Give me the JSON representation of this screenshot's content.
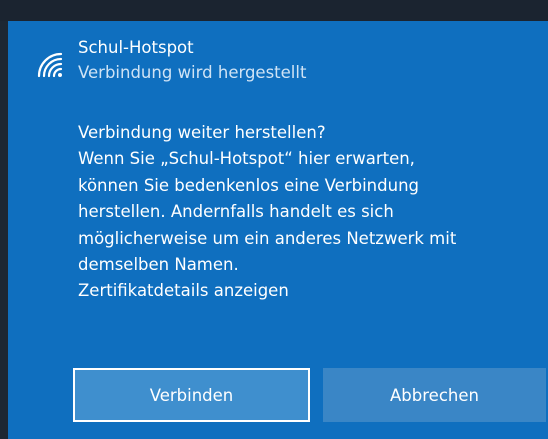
{
  "network": {
    "name": "Schul-Hotspot",
    "status": "Verbindung wird hergestellt",
    "icon": "wifi-signal-icon"
  },
  "message": {
    "lines": [
      "Verbindung weiter herstellen?",
      "Wenn Sie „Schul-Hotspot“ hier erwarten,",
      "können Sie bedenkenlos eine Verbindung",
      "herstellen. Andernfalls handelt es sich",
      "möglicherweise um ein anderes Netzwerk mit",
      "demselben Namen."
    ],
    "certificate_link": "Zertifikatdetails anzeigen"
  },
  "buttons": {
    "connect_label": "Verbinden",
    "cancel_label": "Abbrechen"
  },
  "colors": {
    "panel": "#0f6fbf",
    "button": "#3f8fce",
    "top_bar": "#1b2430"
  }
}
